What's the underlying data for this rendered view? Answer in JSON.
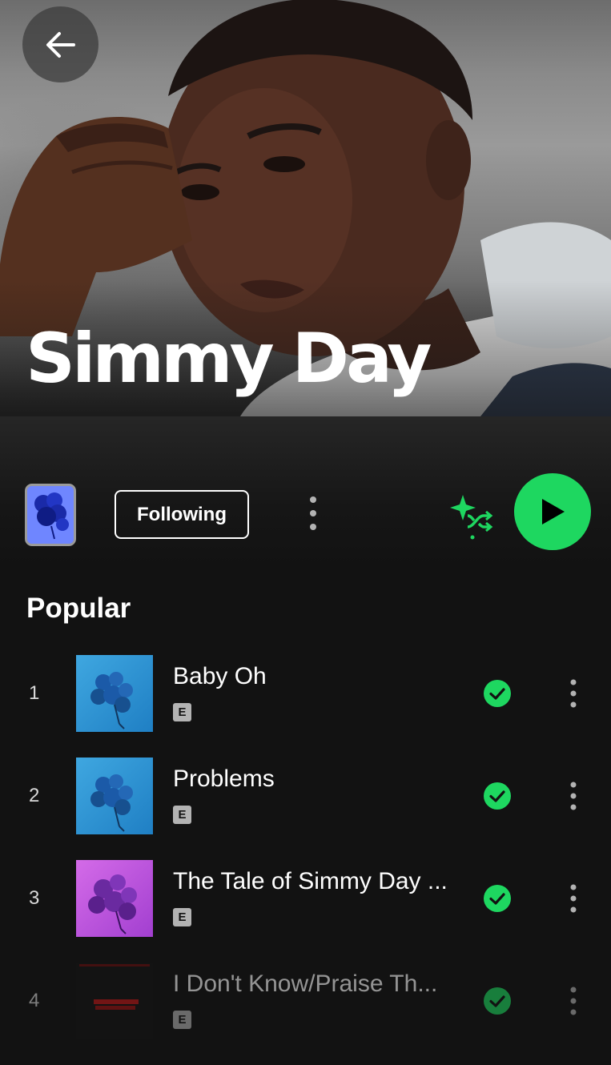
{
  "artist": {
    "name": "Simmy Day"
  },
  "controls": {
    "follow_label": "Following"
  },
  "popular": {
    "title": "Popular",
    "tracks": [
      {
        "index": "1",
        "title": "Baby Oh",
        "explicit": "E"
      },
      {
        "index": "2",
        "title": "Problems",
        "explicit": "E"
      },
      {
        "index": "3",
        "title": "The Tale of Simmy Day ...",
        "explicit": "E"
      },
      {
        "index": "4",
        "title": "I Don't Know/Praise Th...",
        "explicit": "E"
      }
    ]
  },
  "colors": {
    "accent": "#1ed760",
    "background": "#121212"
  },
  "icons": {
    "back": "arrow-left-icon",
    "more": "more-vertical-icon",
    "shuffle": "smart-shuffle-icon",
    "play": "play-icon",
    "saved": "check-circle-icon"
  }
}
